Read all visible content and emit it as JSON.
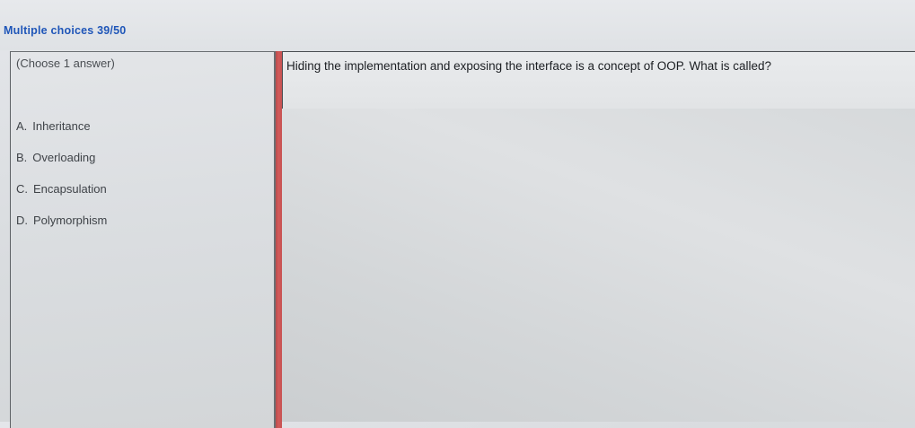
{
  "header": {
    "title": "Multiple choices 39/50"
  },
  "left_panel": {
    "instruction": "(Choose 1 answer)",
    "options": [
      {
        "letter": "A.",
        "text": "Inheritance"
      },
      {
        "letter": "B.",
        "text": "Overloading"
      },
      {
        "letter": "C.",
        "text": "Encapsulation"
      },
      {
        "letter": "D.",
        "text": "Polymorphism"
      }
    ]
  },
  "question": {
    "text": "Hiding the implementation and exposing the interface is a concept of OOP. What is called?"
  },
  "colors": {
    "title_blue": "#1f56b8",
    "divider_red": "#c65252"
  }
}
